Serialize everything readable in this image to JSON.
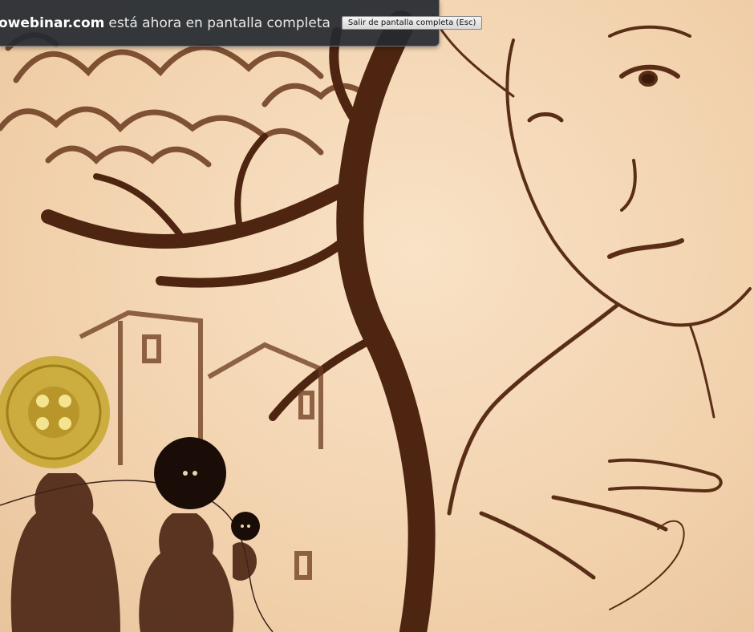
{
  "fullscreen_notice": {
    "domain": "owebinar.com",
    "message": "está ahora en pantalla completa",
    "exit_button_label": "Salir de pantalla completa (Esc)"
  },
  "colors": {
    "sand_background": "#f5d9b8",
    "sand_ink": "#5a2e16",
    "notice_background": "#242930"
  }
}
